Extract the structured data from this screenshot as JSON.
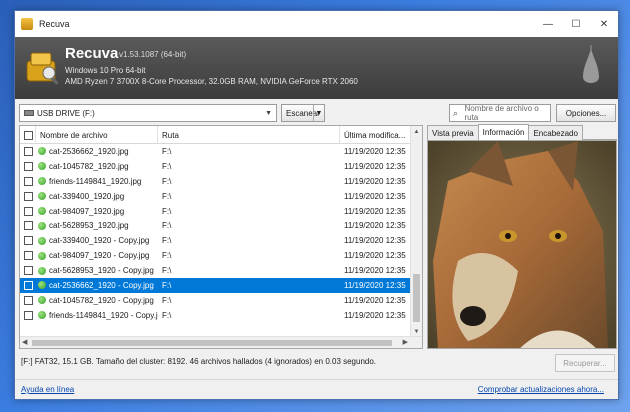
{
  "window": {
    "title": "Recuva"
  },
  "window_controls": {
    "minimize": "—",
    "maximize": "☐",
    "close": "✕"
  },
  "header": {
    "app_name": "Recuva",
    "version": "v1.53.1087 (64-bit)",
    "os": "Windows 10 Pro 64-bit",
    "hardware": "AMD Ryzen 7 3700X 8-Core Processor, 32.0GB RAM, NVIDIA GeForce RTX 2060"
  },
  "toolbar": {
    "drive": "USB DRIVE (F:)",
    "scan_label": "Escanear",
    "search_placeholder": "Nombre de archivo o ruta",
    "options_label": "Opciones..."
  },
  "columns": {
    "name": "Nombre de archivo",
    "path": "Ruta",
    "date": "Última modifica..."
  },
  "files": [
    {
      "name": "cat-2536662_1920.jpg",
      "path": "F:\\",
      "date": "11/19/2020 12:35"
    },
    {
      "name": "cat-1045782_1920.jpg",
      "path": "F:\\",
      "date": "11/19/2020 12:35"
    },
    {
      "name": "friends-1149841_1920.jpg",
      "path": "F:\\",
      "date": "11/19/2020 12:35"
    },
    {
      "name": "cat-339400_1920.jpg",
      "path": "F:\\",
      "date": "11/19/2020 12:35"
    },
    {
      "name": "cat-984097_1920.jpg",
      "path": "F:\\",
      "date": "11/19/2020 12:35"
    },
    {
      "name": "cat-5628953_1920.jpg",
      "path": "F:\\",
      "date": "11/19/2020 12:35"
    },
    {
      "name": "cat-339400_1920 - Copy.jpg",
      "path": "F:\\",
      "date": "11/19/2020 12:35"
    },
    {
      "name": "cat-984097_1920 - Copy.jpg",
      "path": "F:\\",
      "date": "11/19/2020 12:35"
    },
    {
      "name": "cat-5628953_1920 - Copy.jpg",
      "path": "F:\\",
      "date": "11/19/2020 12:35"
    },
    {
      "name": "cat-2536662_1920 - Copy.jpg",
      "path": "F:\\",
      "date": "11/19/2020 12:35",
      "selected": true
    },
    {
      "name": "cat-1045782_1920 - Copy.jpg",
      "path": "F:\\",
      "date": "11/19/2020 12:35"
    },
    {
      "name": "friends-1149841_1920 - Copy.jpg",
      "path": "F:\\",
      "date": "11/19/2020 12:35"
    }
  ],
  "preview_tabs": [
    "Vista previa",
    "Información",
    "Encabezado"
  ],
  "active_tab": "Información",
  "status": "[F:] FAT32, 15.1 GB. Tamaño del cluster: 8192. 46 archivos hallados (4 ignorados) en 0.03 segundo.",
  "recover_label": "Recuperar...",
  "footer": {
    "help_link": "Ayuda en línea",
    "update_link": "Comprobar actualizaciones ahora..."
  },
  "colors": {
    "selection": "#0078d7",
    "link": "#0645ad",
    "header_bg": "#3c3c3c"
  }
}
